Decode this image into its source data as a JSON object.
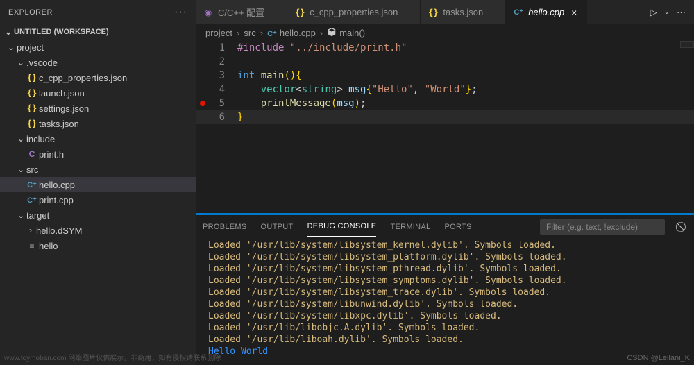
{
  "sidebar": {
    "title": "EXPLORER",
    "workspace": "UNTITLED (WORKSPACE)",
    "tree": [
      {
        "type": "folder",
        "label": "project",
        "depth": 0,
        "open": true
      },
      {
        "type": "folder",
        "label": ".vscode",
        "depth": 1,
        "open": true
      },
      {
        "type": "file",
        "label": "c_cpp_properties.json",
        "depth": 2,
        "icon": "json"
      },
      {
        "type": "file",
        "label": "launch.json",
        "depth": 2,
        "icon": "json"
      },
      {
        "type": "file",
        "label": "settings.json",
        "depth": 2,
        "icon": "json"
      },
      {
        "type": "file",
        "label": "tasks.json",
        "depth": 2,
        "icon": "json"
      },
      {
        "type": "folder",
        "label": "include",
        "depth": 1,
        "open": true
      },
      {
        "type": "file",
        "label": "print.h",
        "depth": 2,
        "icon": "c"
      },
      {
        "type": "folder",
        "label": "src",
        "depth": 1,
        "open": true
      },
      {
        "type": "file",
        "label": "hello.cpp",
        "depth": 2,
        "icon": "cpp",
        "active": true
      },
      {
        "type": "file",
        "label": "print.cpp",
        "depth": 2,
        "icon": "cpp"
      },
      {
        "type": "folder",
        "label": "target",
        "depth": 1,
        "open": true
      },
      {
        "type": "folder",
        "label": "hello.dSYM",
        "depth": 2,
        "open": false
      },
      {
        "type": "file",
        "label": "hello",
        "depth": 2,
        "icon": "bin"
      }
    ]
  },
  "tabs": [
    {
      "label": "C/C++ 配置",
      "icon": "config",
      "active": false
    },
    {
      "label": "c_cpp_properties.json",
      "icon": "json",
      "active": false
    },
    {
      "label": "tasks.json",
      "icon": "json",
      "active": false
    },
    {
      "label": "hello.cpp",
      "icon": "cpp",
      "active": true
    }
  ],
  "breadcrumb": {
    "parts": [
      "project",
      "src",
      "hello.cpp",
      "main()"
    ],
    "fileIcon": "cpp",
    "symbolIcon": "cube"
  },
  "code": {
    "breakpointLine": 5,
    "highlightLine": 6,
    "lines": [
      {
        "n": 1,
        "tokens": [
          [
            "pp",
            "#include"
          ],
          [
            "op",
            " "
          ],
          [
            "str",
            "\"../include/print.h\""
          ]
        ]
      },
      {
        "n": 2,
        "tokens": []
      },
      {
        "n": 3,
        "tokens": [
          [
            "kw",
            "int"
          ],
          [
            "op",
            " "
          ],
          [
            "fn",
            "main"
          ],
          [
            "brace",
            "(){"
          ]
        ]
      },
      {
        "n": 4,
        "tokens": [
          [
            "op",
            "    "
          ],
          [
            "type",
            "vector"
          ],
          [
            "op",
            "<"
          ],
          [
            "type",
            "string"
          ],
          [
            "op",
            "> "
          ],
          [
            "var",
            "msg"
          ],
          [
            "brace",
            "{"
          ],
          [
            "str",
            "\"Hello\""
          ],
          [
            "op",
            ", "
          ],
          [
            "str",
            "\"World\""
          ],
          [
            "brace",
            "}"
          ],
          [
            "op",
            ";"
          ]
        ]
      },
      {
        "n": 5,
        "tokens": [
          [
            "op",
            "    "
          ],
          [
            "fn",
            "printMessage"
          ],
          [
            "brace",
            "("
          ],
          [
            "var",
            "msg"
          ],
          [
            "brace",
            ")"
          ],
          [
            "op",
            ";"
          ]
        ]
      },
      {
        "n": 6,
        "tokens": [
          [
            "brace",
            "}"
          ]
        ]
      }
    ]
  },
  "panel": {
    "tabs": [
      "PROBLEMS",
      "OUTPUT",
      "DEBUG CONSOLE",
      "TERMINAL",
      "PORTS"
    ],
    "active": "DEBUG CONSOLE",
    "filterPlaceholder": "Filter (e.g. text, !exclude)",
    "lines": [
      {
        "cls": "yellow",
        "text": "Loaded '/usr/lib/system/libsystem_kernel.dylib'. Symbols loaded."
      },
      {
        "cls": "yellow",
        "text": "Loaded '/usr/lib/system/libsystem_platform.dylib'. Symbols loaded."
      },
      {
        "cls": "yellow",
        "text": "Loaded '/usr/lib/system/libsystem_pthread.dylib'. Symbols loaded."
      },
      {
        "cls": "yellow",
        "text": "Loaded '/usr/lib/system/libsystem_symptoms.dylib'. Symbols loaded."
      },
      {
        "cls": "yellow",
        "text": "Loaded '/usr/lib/system/libsystem_trace.dylib'. Symbols loaded."
      },
      {
        "cls": "yellow",
        "text": "Loaded '/usr/lib/system/libunwind.dylib'. Symbols loaded."
      },
      {
        "cls": "yellow",
        "text": "Loaded '/usr/lib/system/libxpc.dylib'. Symbols loaded."
      },
      {
        "cls": "yellow",
        "text": "Loaded '/usr/lib/libobjc.A.dylib'. Symbols loaded."
      },
      {
        "cls": "yellow",
        "text": "Loaded '/usr/lib/liboah.dylib'. Symbols loaded."
      },
      {
        "cls": "blue",
        "text": "Hello World"
      }
    ]
  },
  "watermark": "CSDN @Leilani_K",
  "watermark_left": "www.toymoban.com 网络图片仅供展示，非商用，如有侵权请联系删除"
}
